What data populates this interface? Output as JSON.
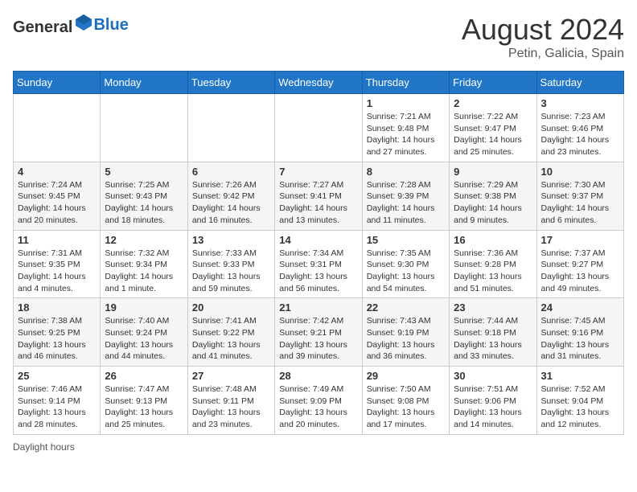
{
  "header": {
    "logo_general": "General",
    "logo_blue": "Blue",
    "month_year": "August 2024",
    "location": "Petin, Galicia, Spain"
  },
  "weekdays": [
    "Sunday",
    "Monday",
    "Tuesday",
    "Wednesday",
    "Thursday",
    "Friday",
    "Saturday"
  ],
  "weeks": [
    [
      {
        "day": "",
        "info": ""
      },
      {
        "day": "",
        "info": ""
      },
      {
        "day": "",
        "info": ""
      },
      {
        "day": "",
        "info": ""
      },
      {
        "day": "1",
        "info": "Sunrise: 7:21 AM\nSunset: 9:48 PM\nDaylight: 14 hours and 27 minutes."
      },
      {
        "day": "2",
        "info": "Sunrise: 7:22 AM\nSunset: 9:47 PM\nDaylight: 14 hours and 25 minutes."
      },
      {
        "day": "3",
        "info": "Sunrise: 7:23 AM\nSunset: 9:46 PM\nDaylight: 14 hours and 23 minutes."
      }
    ],
    [
      {
        "day": "4",
        "info": "Sunrise: 7:24 AM\nSunset: 9:45 PM\nDaylight: 14 hours and 20 minutes."
      },
      {
        "day": "5",
        "info": "Sunrise: 7:25 AM\nSunset: 9:43 PM\nDaylight: 14 hours and 18 minutes."
      },
      {
        "day": "6",
        "info": "Sunrise: 7:26 AM\nSunset: 9:42 PM\nDaylight: 14 hours and 16 minutes."
      },
      {
        "day": "7",
        "info": "Sunrise: 7:27 AM\nSunset: 9:41 PM\nDaylight: 14 hours and 13 minutes."
      },
      {
        "day": "8",
        "info": "Sunrise: 7:28 AM\nSunset: 9:39 PM\nDaylight: 14 hours and 11 minutes."
      },
      {
        "day": "9",
        "info": "Sunrise: 7:29 AM\nSunset: 9:38 PM\nDaylight: 14 hours and 9 minutes."
      },
      {
        "day": "10",
        "info": "Sunrise: 7:30 AM\nSunset: 9:37 PM\nDaylight: 14 hours and 6 minutes."
      }
    ],
    [
      {
        "day": "11",
        "info": "Sunrise: 7:31 AM\nSunset: 9:35 PM\nDaylight: 14 hours and 4 minutes."
      },
      {
        "day": "12",
        "info": "Sunrise: 7:32 AM\nSunset: 9:34 PM\nDaylight: 14 hours and 1 minute."
      },
      {
        "day": "13",
        "info": "Sunrise: 7:33 AM\nSunset: 9:33 PM\nDaylight: 13 hours and 59 minutes."
      },
      {
        "day": "14",
        "info": "Sunrise: 7:34 AM\nSunset: 9:31 PM\nDaylight: 13 hours and 56 minutes."
      },
      {
        "day": "15",
        "info": "Sunrise: 7:35 AM\nSunset: 9:30 PM\nDaylight: 13 hours and 54 minutes."
      },
      {
        "day": "16",
        "info": "Sunrise: 7:36 AM\nSunset: 9:28 PM\nDaylight: 13 hours and 51 minutes."
      },
      {
        "day": "17",
        "info": "Sunrise: 7:37 AM\nSunset: 9:27 PM\nDaylight: 13 hours and 49 minutes."
      }
    ],
    [
      {
        "day": "18",
        "info": "Sunrise: 7:38 AM\nSunset: 9:25 PM\nDaylight: 13 hours and 46 minutes."
      },
      {
        "day": "19",
        "info": "Sunrise: 7:40 AM\nSunset: 9:24 PM\nDaylight: 13 hours and 44 minutes."
      },
      {
        "day": "20",
        "info": "Sunrise: 7:41 AM\nSunset: 9:22 PM\nDaylight: 13 hours and 41 minutes."
      },
      {
        "day": "21",
        "info": "Sunrise: 7:42 AM\nSunset: 9:21 PM\nDaylight: 13 hours and 39 minutes."
      },
      {
        "day": "22",
        "info": "Sunrise: 7:43 AM\nSunset: 9:19 PM\nDaylight: 13 hours and 36 minutes."
      },
      {
        "day": "23",
        "info": "Sunrise: 7:44 AM\nSunset: 9:18 PM\nDaylight: 13 hours and 33 minutes."
      },
      {
        "day": "24",
        "info": "Sunrise: 7:45 AM\nSunset: 9:16 PM\nDaylight: 13 hours and 31 minutes."
      }
    ],
    [
      {
        "day": "25",
        "info": "Sunrise: 7:46 AM\nSunset: 9:14 PM\nDaylight: 13 hours and 28 minutes."
      },
      {
        "day": "26",
        "info": "Sunrise: 7:47 AM\nSunset: 9:13 PM\nDaylight: 13 hours and 25 minutes."
      },
      {
        "day": "27",
        "info": "Sunrise: 7:48 AM\nSunset: 9:11 PM\nDaylight: 13 hours and 23 minutes."
      },
      {
        "day": "28",
        "info": "Sunrise: 7:49 AM\nSunset: 9:09 PM\nDaylight: 13 hours and 20 minutes."
      },
      {
        "day": "29",
        "info": "Sunrise: 7:50 AM\nSunset: 9:08 PM\nDaylight: 13 hours and 17 minutes."
      },
      {
        "day": "30",
        "info": "Sunrise: 7:51 AM\nSunset: 9:06 PM\nDaylight: 13 hours and 14 minutes."
      },
      {
        "day": "31",
        "info": "Sunrise: 7:52 AM\nSunset: 9:04 PM\nDaylight: 13 hours and 12 minutes."
      }
    ]
  ],
  "footer": {
    "note": "Daylight hours"
  }
}
